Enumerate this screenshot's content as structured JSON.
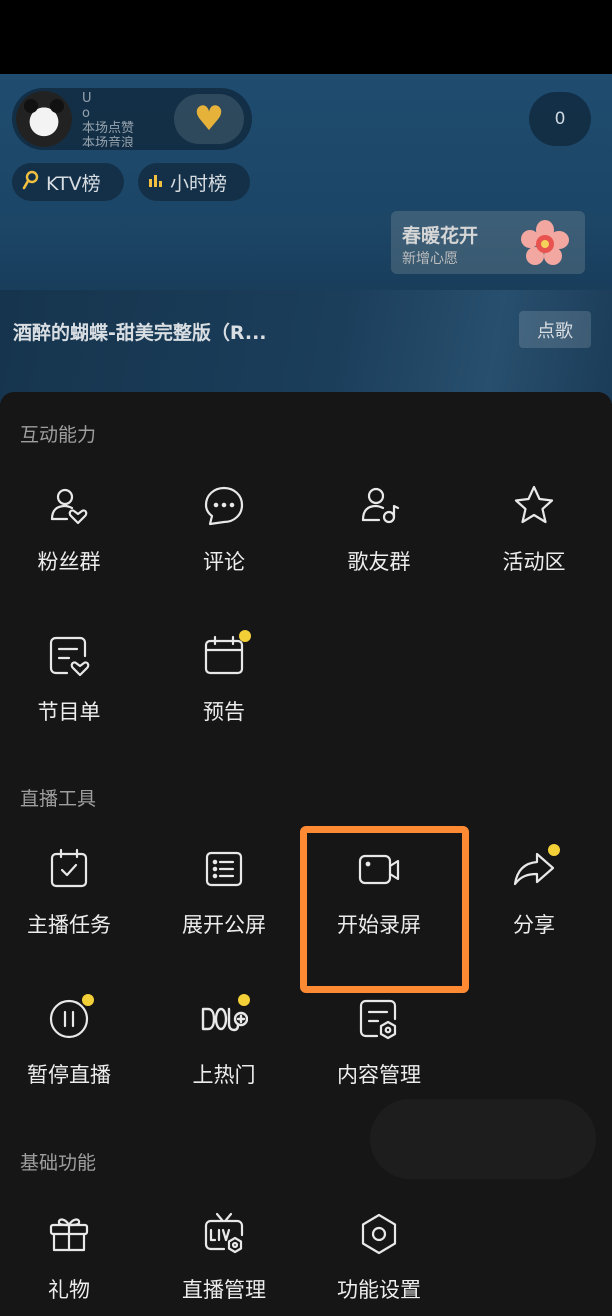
{
  "live": {
    "anchor_lines": [
      "U",
      "o",
      "本场点赞",
      "本场音浪"
    ],
    "viewer_count": "0",
    "rank_ktv": "KTV榜",
    "rank_hour": "小时榜",
    "wish_title": "春暖花开",
    "wish_sub": "新增心愿",
    "song_title": "酒醉的蝴蝶-甜美完整版（R...",
    "song_button": "点歌"
  },
  "panel": {
    "sections": [
      {
        "title": "互动能力",
        "items": [
          {
            "label": "粉丝群",
            "icon": "fans-group-icon"
          },
          {
            "label": "评论",
            "icon": "comment-icon"
          },
          {
            "label": "歌友群",
            "icon": "song-friends-icon"
          },
          {
            "label": "活动区",
            "icon": "star-icon"
          },
          {
            "label": "节目单",
            "icon": "program-list-icon"
          },
          {
            "label": "预告",
            "icon": "calendar-icon",
            "dot": true
          }
        ]
      },
      {
        "title": "直播工具",
        "items": [
          {
            "label": "主播任务",
            "icon": "task-icon"
          },
          {
            "label": "展开公屏",
            "icon": "list-icon"
          },
          {
            "label": "开始录屏",
            "icon": "video-record-icon"
          },
          {
            "label": "分享",
            "icon": "share-icon",
            "dot": true
          },
          {
            "label": "暂停直播",
            "icon": "pause-icon",
            "dot": true
          },
          {
            "label": "上热门",
            "icon": "dou-plus-icon",
            "dot": true
          },
          {
            "label": "内容管理",
            "icon": "content-manage-icon"
          }
        ]
      },
      {
        "title": "基础功能",
        "items": [
          {
            "label": "礼物",
            "icon": "gift-icon"
          },
          {
            "label": "直播管理",
            "icon": "live-manage-icon"
          },
          {
            "label": "功能设置",
            "icon": "settings-icon"
          }
        ]
      }
    ]
  },
  "colors": {
    "highlight": "#ff8a34",
    "dot": "#f3cf38",
    "panel": "#161616"
  }
}
